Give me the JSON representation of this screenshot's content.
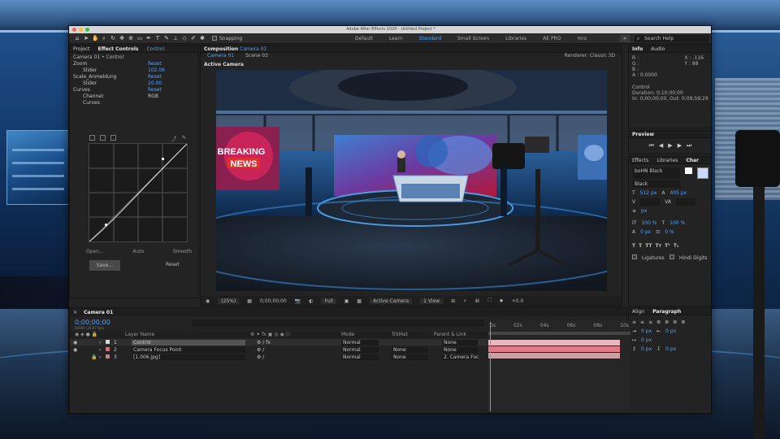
{
  "window": {
    "title": "Adobe After Effects 2020 - Untitled Project *"
  },
  "toolbar": {
    "snapping_label": "Snapping",
    "workspaces": [
      "Default",
      "Learn",
      "Standard",
      "Small Screen",
      "Libraries",
      "AE PRO",
      "mrs"
    ],
    "active_workspace": "Standard",
    "search_placeholder": "Search Help"
  },
  "project_panel": {
    "tab_project": "Project",
    "tab_effect": "Effect Controls",
    "effect_target": "Control"
  },
  "effect_controls": {
    "layer_path": "Camera 01 • Control",
    "rows": [
      {
        "name": "Zoom",
        "val": "Reset"
      },
      {
        "name": "Slider",
        "val": "102.06"
      },
      {
        "name": "Scale_Anmeldung",
        "val": "Reset"
      },
      {
        "name": "Slider",
        "val": "20.00"
      },
      {
        "name": "Curves",
        "val": "Reset"
      },
      {
        "name": "Channel:",
        "val": "RGB"
      },
      {
        "name": "Curves",
        "val": ""
      }
    ],
    "btn_open": "Open...",
    "btn_auto": "Auto",
    "btn_smooth": "Smooth",
    "btn_save": "Save...",
    "btn_reset": "Reset"
  },
  "composition": {
    "tab_label": "Composition",
    "comp_name": "Camera 01",
    "subtabs": [
      "Camera 01",
      "Scene 03"
    ],
    "renderer_label": "Renderer:",
    "renderer": "Classic 3D",
    "active_camera_label": "Active Camera",
    "news_text_1": "BREAKING",
    "news_text_2": "NEWS",
    "footer": {
      "zoom": "(25%)",
      "timecode": "0;00;00;00",
      "resolution": "Full",
      "view": "Active Camera",
      "views": "1 View",
      "offset": "+0.0"
    }
  },
  "info_panel": {
    "tab_info": "Info",
    "tab_audio": "Audio",
    "rgb": [
      "R :",
      "G :",
      "B :",
      "A : 0.0000"
    ],
    "coords_x": "X : -116",
    "coords_y": "Y : 88",
    "layer": "Control",
    "duration": "Duration: 0;10;00;00",
    "in_out": "In: 0;00;00;00, Out: 0;09;59;29"
  },
  "preview_panel": {
    "title": "Preview"
  },
  "character_panel": {
    "tab_effects": "Effects",
    "tab_libraries": "Libraries",
    "tab_character": "Char",
    "font": "boHN Black",
    "style": "Black",
    "size": "512 px",
    "leading": "405 px",
    "tracking_unit": "px",
    "scale_v": "100 %",
    "scale_h": "100 %",
    "baseline": "0 px",
    "tsume": "0 %",
    "ligatures": "Ligatures",
    "hindi": "Hindi Digits"
  },
  "align_panel": {
    "tab_align": "Align",
    "tab_paragraph": "Paragraph",
    "values": [
      "0 px",
      "0 px",
      "0 px",
      "0 px",
      "0 px"
    ]
  },
  "timeline": {
    "tab_label": "Camera 01",
    "timecode": "0;00;00;00",
    "timecode_sub": "00000 (29.97 fps)",
    "col_layer": "Layer Name",
    "col_mode": "Mode",
    "col_trkmat": "TrkMat",
    "col_parent": "Parent & Link",
    "layers": [
      {
        "num": "1",
        "name": "Control",
        "mode": "Normal",
        "trkmat": "",
        "parent": "None",
        "color": "#d8d8d8"
      },
      {
        "num": "2",
        "name": "Camera Focus Point",
        "mode": "Normal",
        "trkmat": "None",
        "parent": "None",
        "color": "#d96c78"
      },
      {
        "num": "3",
        "name": "[1.006.jpg]",
        "mode": "Normal",
        "trkmat": "None",
        "parent": "2. Camera Foc",
        "color": "#b08a8a"
      }
    ],
    "ruler": [
      "0s",
      "02s",
      "04s",
      "06s",
      "08s",
      "10s"
    ]
  },
  "colors": {
    "accent": "#4ea4ff",
    "layer_bar": "#e07a86",
    "layer_bar_light": "#e8b8bc"
  }
}
